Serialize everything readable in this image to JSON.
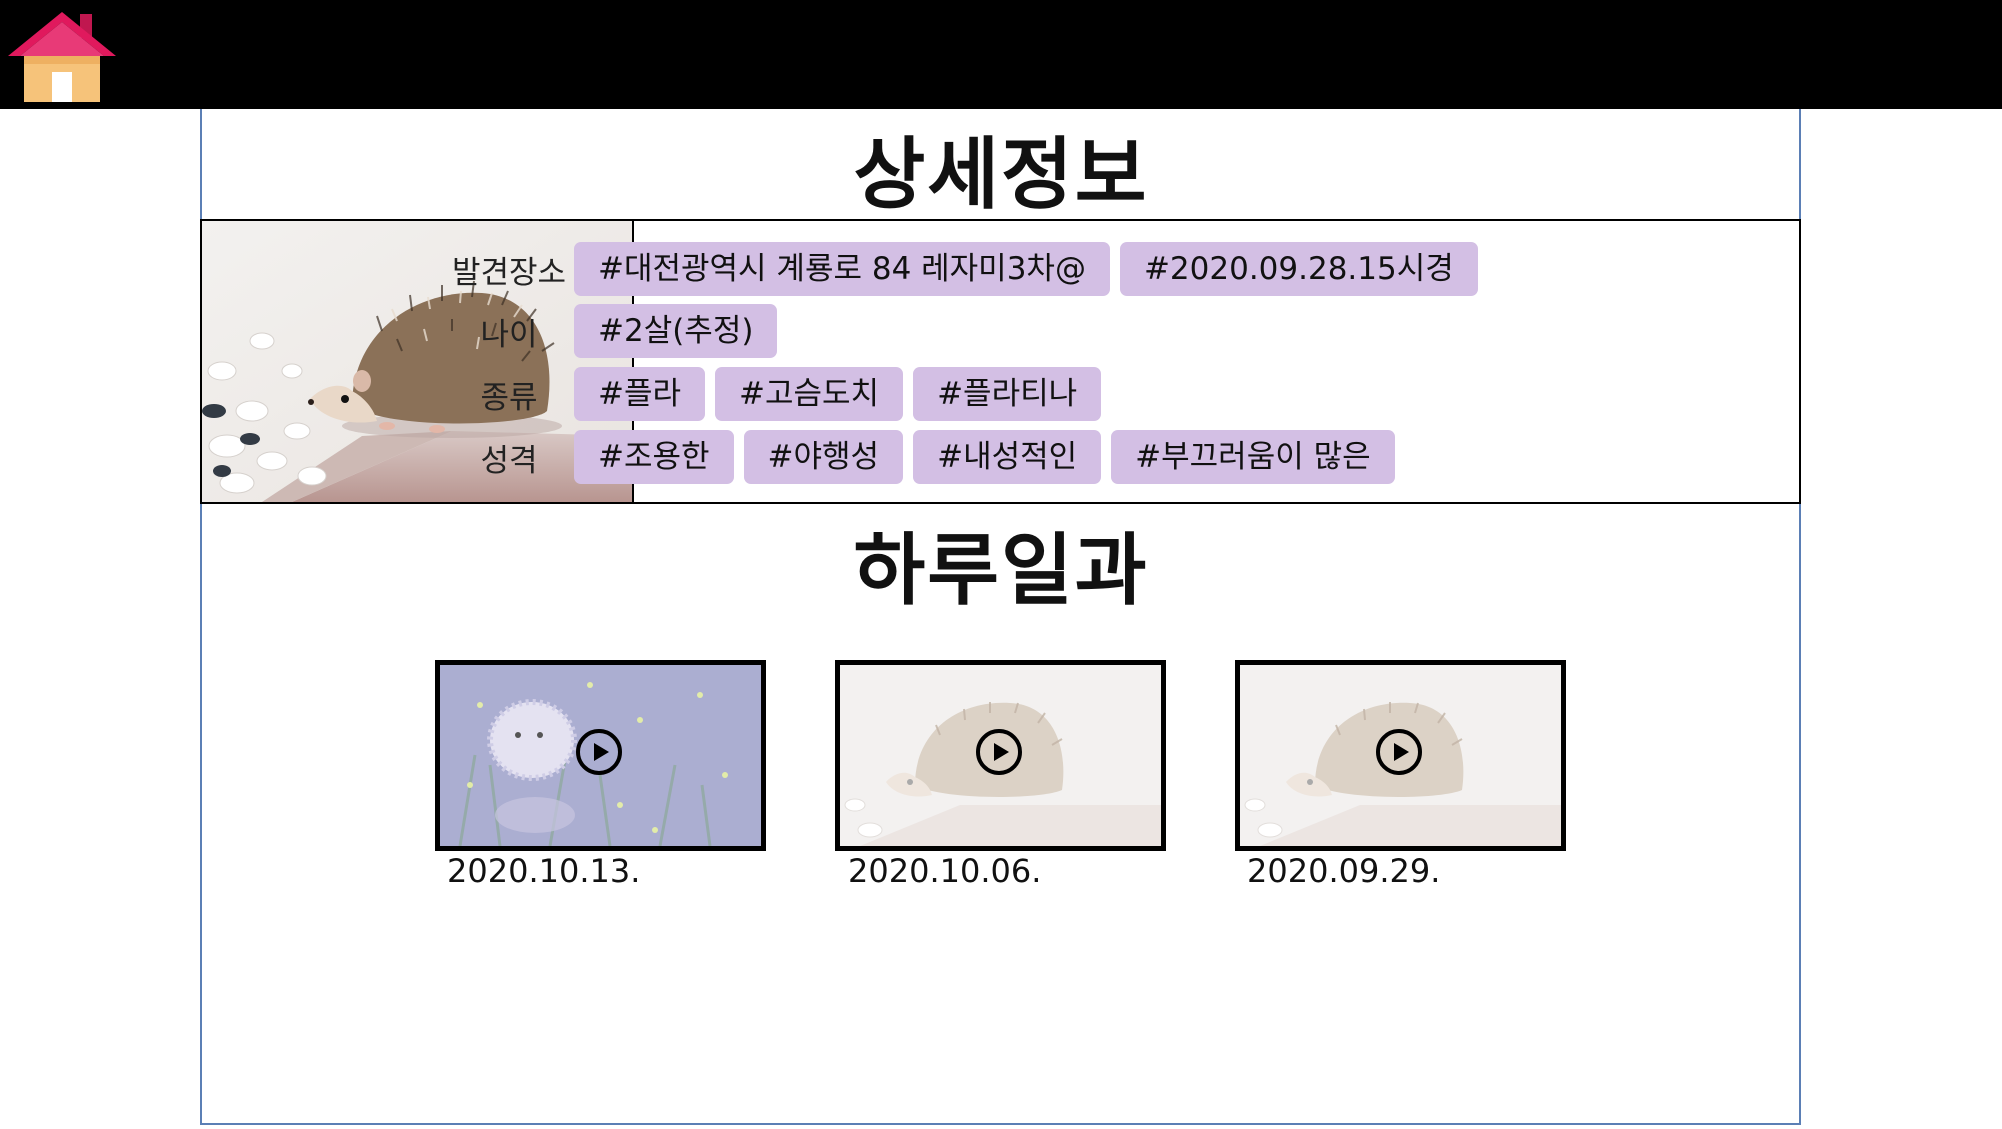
{
  "header": {
    "home_icon": "home-icon"
  },
  "detail": {
    "title": "상세정보",
    "found_place": {
      "label": "발견장소",
      "tags": [
        "#대전광역시 계룡로 84 레자미3차@",
        "#2020.09.28.15시경"
      ]
    },
    "age": {
      "label": "나이",
      "tags": [
        "#2살(추정)"
      ]
    },
    "species": {
      "label": "종류",
      "tags": [
        "#플라",
        "#고슴도치",
        "#플라티나"
      ]
    },
    "personality": {
      "label": "성격",
      "tags": [
        "#조용한",
        "#야행성",
        "#내성적인",
        "#부끄러움이 많은"
      ]
    }
  },
  "diary": {
    "title": "하루일과",
    "videos": [
      {
        "date": "2020.10.13."
      },
      {
        "date": "2020.10.06."
      },
      {
        "date": "2020.09.29."
      }
    ]
  },
  "colors": {
    "tag": "#d3bfe4",
    "frame_border": "#5b7fb5",
    "topbar": "#000000"
  }
}
